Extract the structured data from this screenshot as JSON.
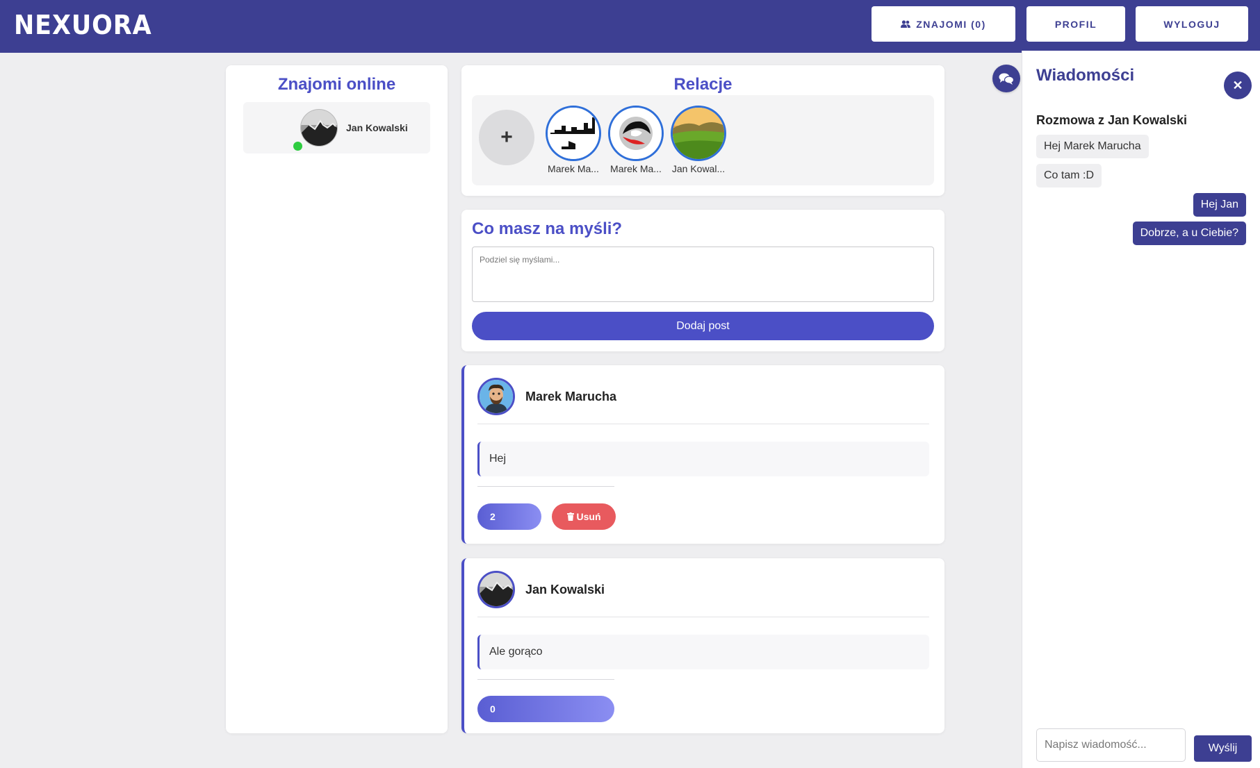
{
  "header": {
    "logo": "NEXUORA",
    "friends_label": "ZNAJOMI (0)",
    "profile_label": "PROFIL",
    "logout_label": "WYLOGUJ"
  },
  "friends_online": {
    "title": "Znajomi online",
    "items": [
      {
        "name": "Jan Kowalski",
        "status": "online"
      }
    ]
  },
  "relations": {
    "title": "Relacje",
    "add_label": "+",
    "items": [
      {
        "name": "Marek Ma..."
      },
      {
        "name": "Marek Ma..."
      },
      {
        "name": "Jan Kowal..."
      }
    ]
  },
  "composer": {
    "title": "Co masz na myśli?",
    "placeholder": "Podziel się myślami...",
    "submit_label": "Dodaj post"
  },
  "posts": [
    {
      "author": "Marek Marucha",
      "content": "Hej",
      "likes": "2",
      "delete_label": "Usuń"
    },
    {
      "author": "Jan Kowalski",
      "content": "Ale gorąco",
      "likes": "0"
    }
  ],
  "messages": {
    "title": "Wiadomości",
    "conversation_title": "Rozmowa z Jan Kowalski",
    "items": [
      {
        "text": "Hej Marek Marucha",
        "direction": "incoming"
      },
      {
        "text": "Co tam :D",
        "direction": "incoming"
      },
      {
        "text": "Hej Jan",
        "direction": "outgoing"
      },
      {
        "text": "Dobrze, a u Ciebie?",
        "direction": "outgoing"
      }
    ],
    "input_placeholder": "Napisz wiadomość...",
    "send_label": "Wyślij",
    "close_label": "✕"
  },
  "colors": {
    "header": "#3d3f92",
    "accent": "#4b4fc6",
    "online": "#2ecc40",
    "delete": "#e85a5e"
  }
}
